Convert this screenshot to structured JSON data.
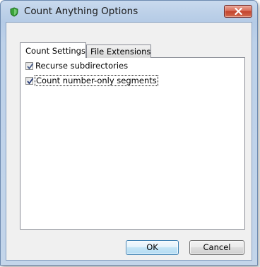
{
  "window": {
    "title": "Count Anything Options"
  },
  "tabs": [
    {
      "label": "Count Settings",
      "active": true
    },
    {
      "label": "File Extensions",
      "active": false
    }
  ],
  "options": [
    {
      "label": "Recurse subdirectories",
      "checked": true
    },
    {
      "label": "Count number-only segments",
      "checked": true
    }
  ],
  "buttons": {
    "ok_label": "OK",
    "cancel_label": "Cancel"
  },
  "colors": {
    "accent": "#3c7fb1",
    "close": "#c4432c",
    "app_icon": "#3aa33a"
  },
  "icons": {
    "app": "green-shield-icon",
    "close": "close-icon",
    "check": "checkmark-icon"
  }
}
